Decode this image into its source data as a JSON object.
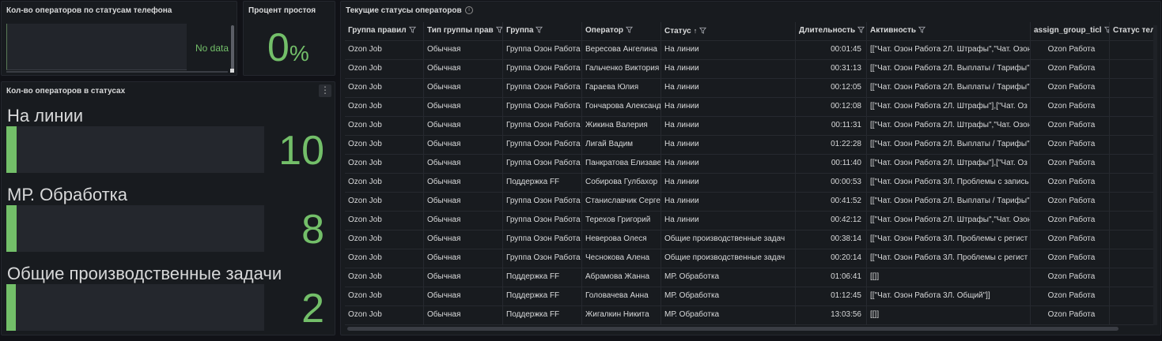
{
  "panel_phone": {
    "title": "Кол-во операторов по статусам телефона",
    "no_data": "No data"
  },
  "panel_idle": {
    "title": "Процент простоя",
    "value": "0",
    "unit": "%"
  },
  "panel_status_counts": {
    "title": "Кол-во операторов в статусах",
    "menu_icon": "vertical-dots-icon",
    "accent_color": "#73bf69",
    "items": [
      {
        "label": "На линии",
        "value": "10",
        "fill_fraction": 0.04
      },
      {
        "label": "МР. Обработка",
        "value": "8",
        "fill_fraction": 0.04
      },
      {
        "label": "Общие производственные задачи",
        "value": "2",
        "fill_fraction": 0.01
      }
    ]
  },
  "panel_table": {
    "title": "Текущие статусы операторов",
    "info_icon": "info-icon",
    "columns": [
      {
        "label": "Группа правил",
        "filter": true
      },
      {
        "label": "Тип группы прав",
        "filter": true
      },
      {
        "label": "Группа",
        "filter": true
      },
      {
        "label": "Оператор",
        "filter": true
      },
      {
        "label": "Статус",
        "filter": true,
        "sort": "↑"
      },
      {
        "label": "Длительность",
        "filter": true
      },
      {
        "label": "Активность",
        "filter": true
      },
      {
        "label": "assign_group_ticl",
        "filter": true
      },
      {
        "label": "Статус теле",
        "filter": false
      }
    ],
    "rows": [
      [
        "Ozon Job",
        "Обычная",
        "Группа Озон Работа",
        "Вересова Ангелина",
        "На линии",
        "00:01:45",
        "[[\"Чат. Озон Работа 2Л. Штрафы\",\"Чат. Озон",
        "Ozon Работа"
      ],
      [
        "Ozon Job",
        "Обычная",
        "Группа Озон Работа",
        "Гальченко Виктория",
        "На линии",
        "00:31:13",
        "[[\"Чат. Озон Работа 2Л. Выплаты / Тарифы\"",
        "Ozon Работа"
      ],
      [
        "Ozon Job",
        "Обычная",
        "Группа Озон Работа",
        "Гараева Юлия",
        "На линии",
        "00:12:05",
        "[[\"Чат. Озон Работа 2Л. Выплаты / Тарифы\"",
        "Ozon Работа"
      ],
      [
        "Ozon Job",
        "Обычная",
        "Группа Озон Работа",
        "Гончарова Александ",
        "На линии",
        "00:12:08",
        "[[\"Чат. Озон Работа 2Л. Штрафы\"],[\"Чат. Оз",
        "Ozon Работа"
      ],
      [
        "Ozon Job",
        "Обычная",
        "Группа Озон Работа",
        "Жикина Валерия",
        "На линии",
        "00:11:31",
        "[[\"Чат. Озон Работа 2Л. Штрафы\",\"Чат. Озон",
        "Ozon Работа"
      ],
      [
        "Ozon Job",
        "Обычная",
        "Группа Озон Работа",
        "Лигай Вадим",
        "На линии",
        "01:22:28",
        "[[\"Чат. Озон Работа 2Л. Выплаты / Тарифы\"",
        "Ozon Работа"
      ],
      [
        "Ozon Job",
        "Обычная",
        "Группа Озон Работа",
        "Панкратова Елизаве",
        "На линии",
        "00:11:40",
        "[[\"Чат. Озон Работа 2Л. Штрафы\"],[\"Чат. Оз",
        "Ozon Работа"
      ],
      [
        "Ozon Job",
        "Обычная",
        "Поддержка FF",
        "Собирова Гулбахор",
        "На линии",
        "00:00:53",
        "[[\"Чат. Озон Работа 3Л. Проблемы с запись",
        "Ozon Работа"
      ],
      [
        "Ozon Job",
        "Обычная",
        "Группа Озон Работа",
        "Станиславчик Серге",
        "На линии",
        "00:41:52",
        "[[\"Чат. Озон Работа 2Л. Выплаты / Тарифы\"",
        "Ozon Работа"
      ],
      [
        "Ozon Job",
        "Обычная",
        "Группа Озон Работа",
        "Терехов Григорий",
        "На линии",
        "00:42:12",
        "[[\"Чат. Озон Работа 2Л. Штрафы\",\"Чат. Озон",
        "Ozon Работа"
      ],
      [
        "Ozon Job",
        "Обычная",
        "Группа Озон Работа",
        "Неверова Олеся",
        "Общие производственные задач",
        "00:38:14",
        "[[\"Чат. Озон Работа 3Л. Проблемы с регист",
        "Ozon Работа"
      ],
      [
        "Ozon Job",
        "Обычная",
        "Группа Озон Работа",
        "Чеснокова Алена",
        "Общие производственные задач",
        "00:20:14",
        "[[\"Чат. Озон Работа 3Л. Проблемы с регист",
        "Ozon Работа"
      ],
      [
        "Ozon Job",
        "Обычная",
        "Поддержка FF",
        "Абрамова Жанна",
        "МР. Обработка",
        "01:06:41",
        "[[]]",
        "Ozon Работа"
      ],
      [
        "Ozon Job",
        "Обычная",
        "Поддержка FF",
        "Головачева Анна",
        "МР. Обработка",
        "01:12:45",
        "[[\"Чат. Озон Работа 3Л. Общий\"]]",
        "Ozon Работа"
      ],
      [
        "Ozon Job",
        "Обычная",
        "Поддержка FF",
        "Жигалкин Никита",
        "МР. Обработка",
        "13:03:56",
        "[[]]",
        "Ozon Работа"
      ]
    ]
  }
}
